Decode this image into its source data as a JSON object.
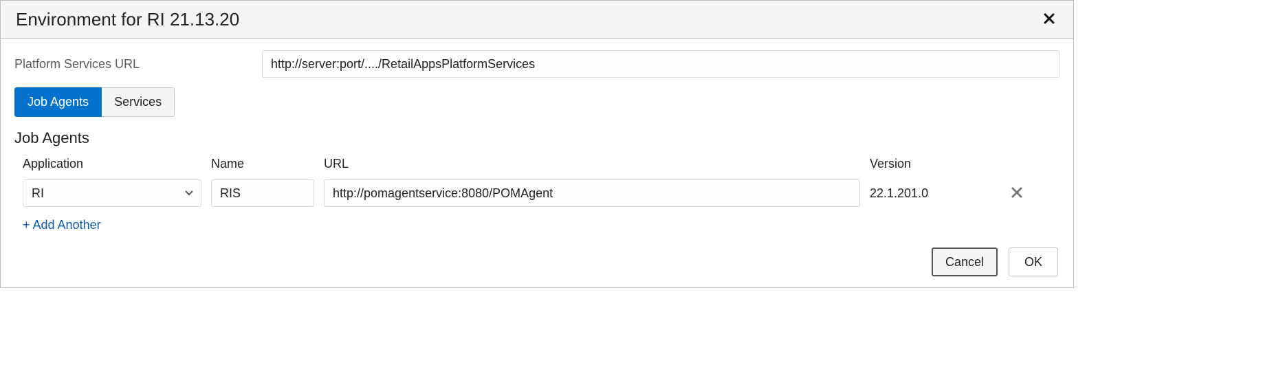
{
  "dialog": {
    "title": "Environment for RI 21.13.20",
    "close_label": "Close"
  },
  "form": {
    "platform_url_label": "Platform Services URL",
    "platform_url_value": "http://server:port/..../RetailAppsPlatformServices"
  },
  "tabs": {
    "job_agents": "Job Agents",
    "services": "Services",
    "active": "job_agents"
  },
  "section": {
    "title": "Job Agents"
  },
  "columns": {
    "application": "Application",
    "name": "Name",
    "url": "URL",
    "version": "Version"
  },
  "rows": [
    {
      "application": "RI",
      "name": "RIS",
      "url": "http://pomagentservice:8080/POMAgent",
      "version": "22.1.201.0"
    }
  ],
  "actions": {
    "add_another": "+ Add Another",
    "cancel": "Cancel",
    "ok": "OK"
  }
}
